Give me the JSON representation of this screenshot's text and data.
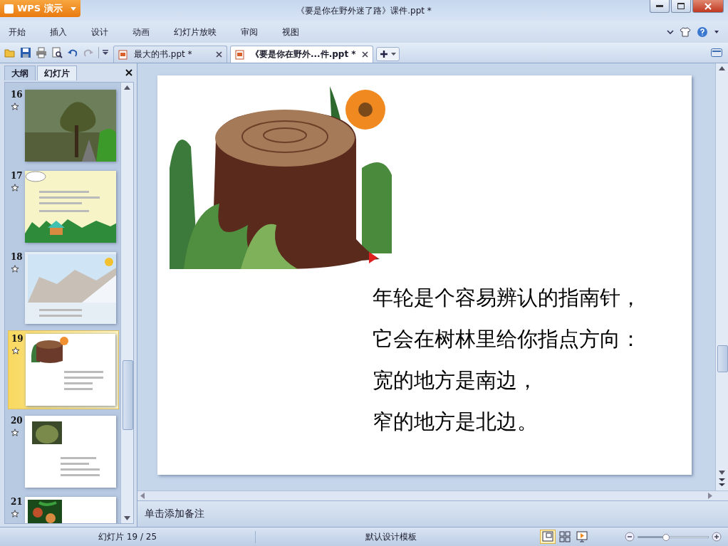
{
  "app_button": {
    "label": "WPS 演示"
  },
  "window": {
    "title": "《要是你在野外迷了路》课件.ppt *"
  },
  "menu": [
    {
      "label": "开始"
    },
    {
      "label": "插入"
    },
    {
      "label": "设计"
    },
    {
      "label": "动画"
    },
    {
      "label": "幻灯片放映"
    },
    {
      "label": "审阅"
    },
    {
      "label": "视图"
    }
  ],
  "doc_tabs": [
    {
      "label": "最大的书.ppt *",
      "selected": false
    },
    {
      "label": "《要是你在野外...件.ppt *",
      "selected": true
    }
  ],
  "panel_tabs": [
    {
      "label": "大纲",
      "selected": false
    },
    {
      "label": "幻灯片",
      "selected": true
    }
  ],
  "slides": [
    {
      "number": "16",
      "selected": false
    },
    {
      "number": "17",
      "selected": false
    },
    {
      "number": "18",
      "selected": false
    },
    {
      "number": "19",
      "selected": true
    },
    {
      "number": "20",
      "selected": false
    },
    {
      "number": "21",
      "selected": false
    }
  ],
  "slide": {
    "lines": [
      "年轮是个容易辨认的指南针，",
      "它会在树林里给你指点方向：",
      "宽的地方是南边，",
      "窄的地方是北边。"
    ]
  },
  "notes": {
    "placeholder": "单击添加备注"
  },
  "status_bar": {
    "slide_position": "幻灯片 19 / 25",
    "template": "默认设计模板",
    "zoom": {
      "level": 0.4
    }
  }
}
